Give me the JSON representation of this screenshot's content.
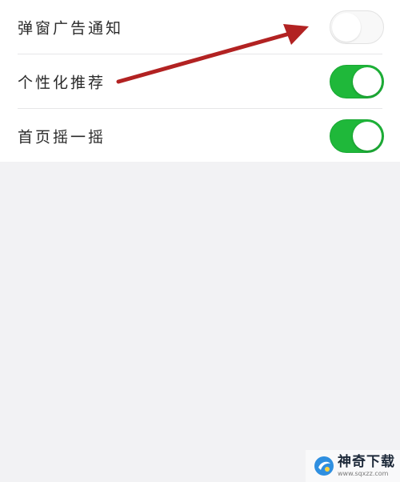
{
  "settings": {
    "rows": [
      {
        "label": "弹窗广告通知",
        "enabled": false
      },
      {
        "label": "个性化推荐",
        "enabled": true
      },
      {
        "label": "首页摇一摇",
        "enabled": true
      }
    ]
  },
  "colors": {
    "toggle_on": "#1fb83a",
    "toggle_off": "#f8f8f8",
    "arrow": "#b22222",
    "background": "#f2f2f4"
  },
  "icons": {
    "annotation": "red-arrow-icon",
    "watermark_logo": "sqxzz-logo-icon"
  },
  "watermark": {
    "name": "神奇下载",
    "url": "www.sqxzz.com"
  }
}
